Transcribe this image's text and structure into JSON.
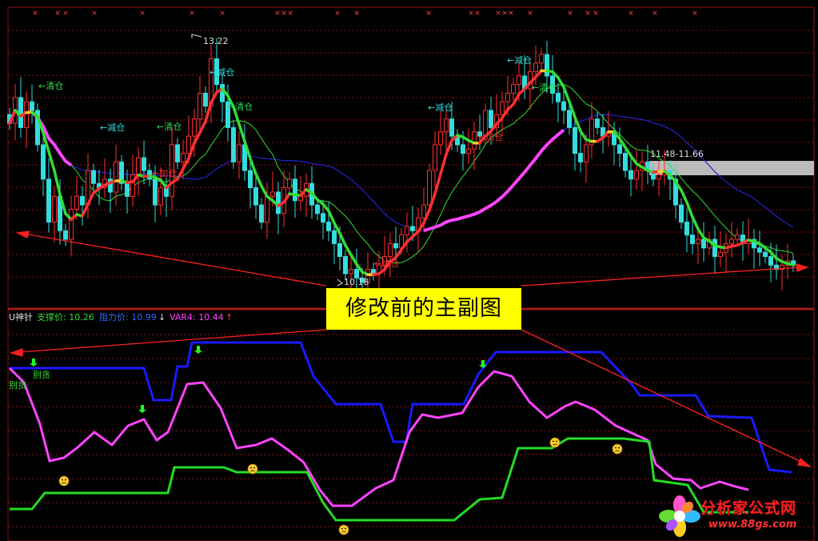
{
  "main_chart": {
    "marks": {
      "high_label": "13.22",
      "low_label": "10.18",
      "range_label": "11.48-11.66"
    },
    "signals": [
      {
        "text": "←清仓",
        "color": "#33dd55"
      },
      {
        "text": "←减仓",
        "color": "#33dddd"
      },
      {
        "text": "←清仓",
        "color": "#33dd55"
      },
      {
        "text": "←加仓",
        "color": "#ff3030"
      },
      {
        "text": "←减仓",
        "color": "#33dddd"
      },
      {
        "text": "←清仓",
        "color": "#33dd55"
      },
      {
        "text": "←加仓",
        "color": "#ff3030"
      },
      {
        "text": "←减仓",
        "color": "#33dddd"
      },
      {
        "text": "←加仓",
        "color": "#ff3030"
      },
      {
        "text": "←减仓",
        "color": "#33dddd"
      },
      {
        "text": "←清仓",
        "color": "#33dd55"
      }
    ]
  },
  "sub_chart": {
    "header": {
      "name": "U神针",
      "support_label": "支撑价: 10.26",
      "resistance_label": "阻力价: 10.99",
      "resistance_arrow": "↓",
      "var4_label": "VAR4: 10.44",
      "var4_arrow": "↑"
    },
    "labels": {
      "bie_tan_1": "别贪",
      "bie_tan_2": "别贪"
    }
  },
  "caption": "修改前的主副图",
  "logo": {
    "name": "分析家公式网",
    "url": "www.88gs.com"
  },
  "colors": {
    "up": "#ff3030",
    "down": "#33dddd",
    "ma_short": "#33dd33",
    "ma_mid": "#2222cc",
    "ma_long": "#ff44ff",
    "support": "#22dd22",
    "resistance": "#1a1aff",
    "var4": "#ff44ff",
    "signal_arrow": "#22ff22",
    "marker": "#ff4444",
    "grid": "#8a1515"
  },
  "chart_data": [
    {
      "type": "candlestick",
      "title": "",
      "ylim": [
        10.0,
        13.5
      ],
      "grid": true,
      "annotations": {
        "high": 13.22,
        "low": 10.18,
        "range": [
          11.48,
          11.66
        ]
      },
      "close": [
        12.15,
        12.45,
        12.1,
        12.4,
        12.3,
        11.9,
        11.5,
        11.0,
        11.3,
        10.9,
        10.8,
        11.15,
        11.3,
        11.2,
        11.6,
        11.45,
        11.4,
        11.5,
        11.35,
        11.7,
        11.45,
        11.3,
        11.55,
        11.75,
        11.6,
        11.5,
        11.2,
        11.4,
        11.3,
        11.9,
        11.7,
        11.8,
        12.0,
        12.2,
        12.5,
        12.35,
        12.9,
        12.6,
        12.4,
        12.1,
        11.7,
        11.9,
        11.6,
        11.4,
        11.2,
        11.0,
        11.3,
        11.35,
        11.1,
        11.4,
        11.5,
        11.25,
        11.3,
        11.45,
        11.2,
        11.1,
        11.0,
        10.9,
        10.75,
        10.6,
        10.4,
        10.45,
        10.35,
        10.3,
        10.45,
        10.4,
        10.5,
        10.6,
        10.75,
        10.7,
        10.85,
        10.95,
        10.9,
        11.05,
        11.2,
        11.6,
        11.9,
        12.05,
        12.2,
        12.0,
        11.9,
        11.8,
        11.85,
        12.05,
        12.0,
        12.3,
        12.1,
        12.25,
        12.4,
        12.5,
        12.6,
        12.7,
        12.55,
        12.75,
        12.85,
        12.95,
        12.7,
        12.5,
        12.4,
        12.3,
        12.1,
        11.8,
        11.7,
        11.9,
        12.2,
        12.1,
        12.0,
        12.05,
        11.9,
        11.8,
        11.6,
        11.5,
        11.6,
        11.7,
        11.6,
        11.5,
        11.55,
        11.6,
        11.5,
        11.2,
        11.0,
        10.85,
        10.75,
        10.8,
        10.7,
        10.8,
        10.6,
        10.65,
        10.75,
        10.8,
        10.85,
        10.75,
        10.8,
        10.7,
        10.65,
        10.6,
        10.5,
        10.45,
        10.5,
        10.55,
        10.5
      ]
    },
    {
      "type": "line",
      "title": "",
      "series": [
        {
          "name": "支撑价",
          "last": 10.26
        },
        {
          "name": "阻力价",
          "last": 10.99
        },
        {
          "name": "VAR4",
          "last": 10.44
        }
      ]
    }
  ]
}
